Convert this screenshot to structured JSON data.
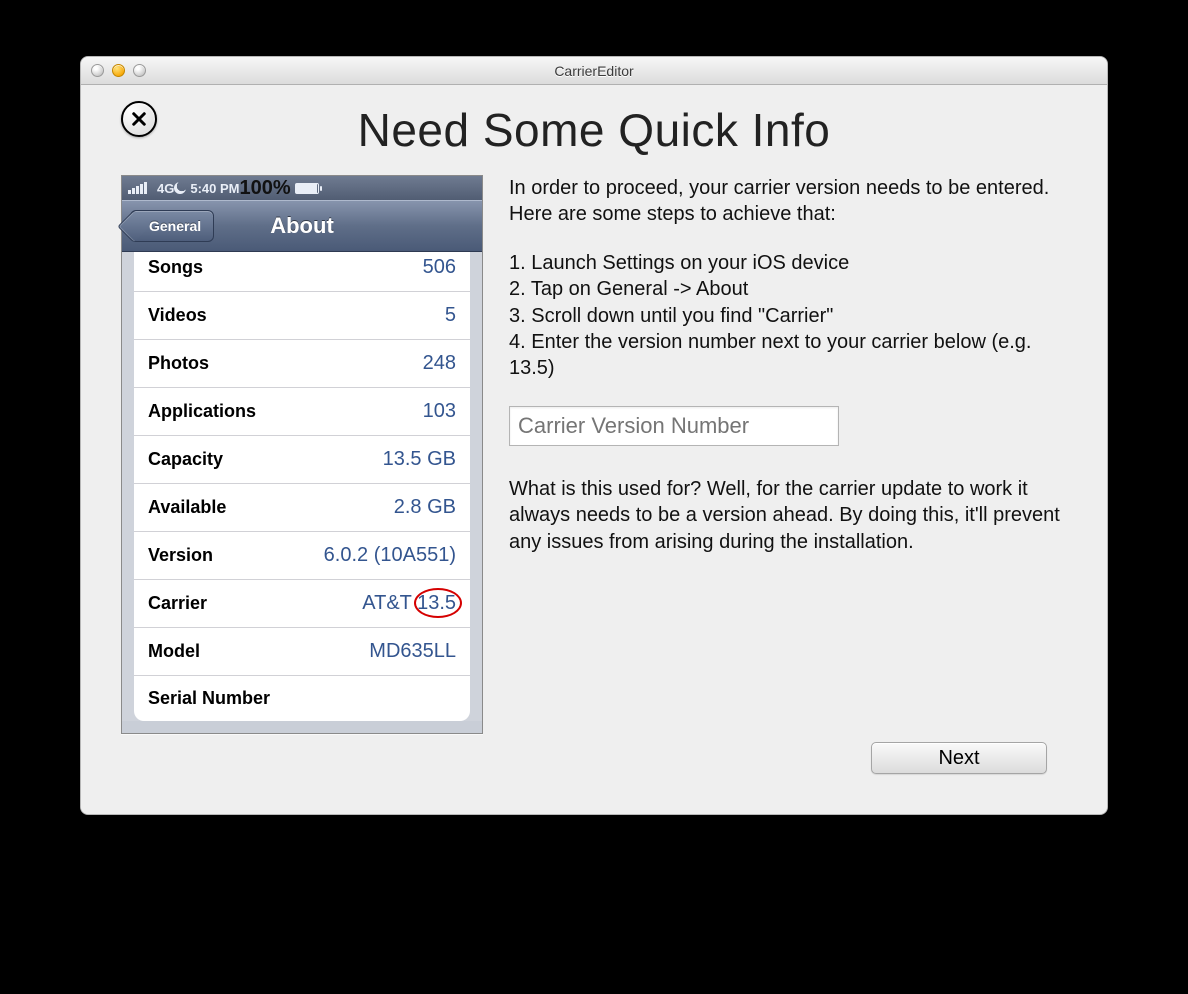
{
  "window": {
    "title": "CarrierEditor"
  },
  "heading": "Need Some Quick Info",
  "phone": {
    "status": {
      "net": "4G",
      "time": "5:40 PM",
      "battery": "100%"
    },
    "nav": {
      "back": "General",
      "title": "About"
    },
    "rows": [
      {
        "label": "Songs",
        "value": "506",
        "partial": true
      },
      {
        "label": "Videos",
        "value": "5"
      },
      {
        "label": "Photos",
        "value": "248"
      },
      {
        "label": "Applications",
        "value": "103"
      },
      {
        "label": "Capacity",
        "value": "13.5 GB"
      },
      {
        "label": "Available",
        "value": "2.8 GB"
      },
      {
        "label": "Version",
        "value": "6.0.2 (10A551)"
      },
      {
        "label": "Carrier",
        "value": "AT&T 13.5",
        "circled": true
      },
      {
        "label": "Model",
        "value": "MD635LL"
      },
      {
        "label": "Serial Number",
        "value": ""
      }
    ]
  },
  "instructions": {
    "intro": "In order to proceed, your carrier version needs to be entered. Here are some steps to achieve that:",
    "steps": [
      "1. Launch Settings on your iOS device",
      "2. Tap on General -> About",
      "3. Scroll down until you find \"Carrier\"",
      "4. Enter the version number next to your carrier below (e.g. 13.5)"
    ],
    "input_placeholder": "Carrier Version Number",
    "explain": "What is this used for? Well, for the carrier update to work it always needs to be a version ahead. By doing this, it'll prevent any issues from arising during the installation."
  },
  "buttons": {
    "next": "Next"
  }
}
